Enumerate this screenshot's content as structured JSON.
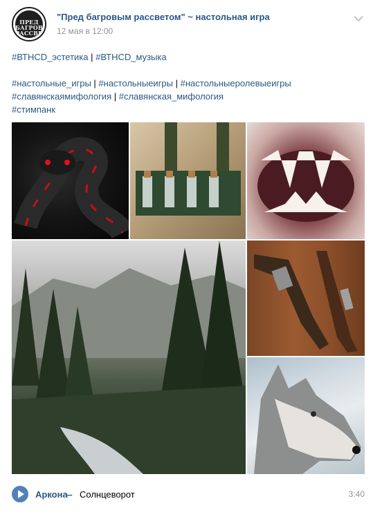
{
  "post": {
    "author": "\"Пред багровым рассветом\" ~ настольная игра",
    "date": "12 мая в 12:00",
    "avatar_text": "ПРЕД БАГРОВЫМ РАССВЕТОМ",
    "text_lines": [
      [
        "#ВТНСD_эстетика",
        "#ВТНСD_музыка"
      ],
      [],
      [
        "#настольные_игры",
        "#настольныеигры",
        "#настольныеролевыеигры"
      ],
      [
        "#славянскаямифология",
        "#славянская_мифология"
      ],
      [
        "#стимпанк"
      ]
    ],
    "separator": " | "
  },
  "photos": [
    {
      "name": "snake-photo",
      "subject": "black snake with red stripes"
    },
    {
      "name": "bottles-photo",
      "subject": "leather belt with glass vials"
    },
    {
      "name": "fangs-photo",
      "subject": "open mouth with fangs"
    },
    {
      "name": "forest-photo",
      "subject": "misty mountains and pine forest with stream"
    },
    {
      "name": "pistol-photo",
      "subject": "antique flintlock pistols on wood"
    },
    {
      "name": "wolf-photo",
      "subject": "grey wolf in snow"
    }
  ],
  "audio": {
    "artist": "Аркона",
    "dash": "–",
    "title": "Солнцеворот",
    "duration": "3:40"
  },
  "colors": {
    "link": "#2a5885",
    "meta": "#939393",
    "play_button": "#5181b8"
  }
}
